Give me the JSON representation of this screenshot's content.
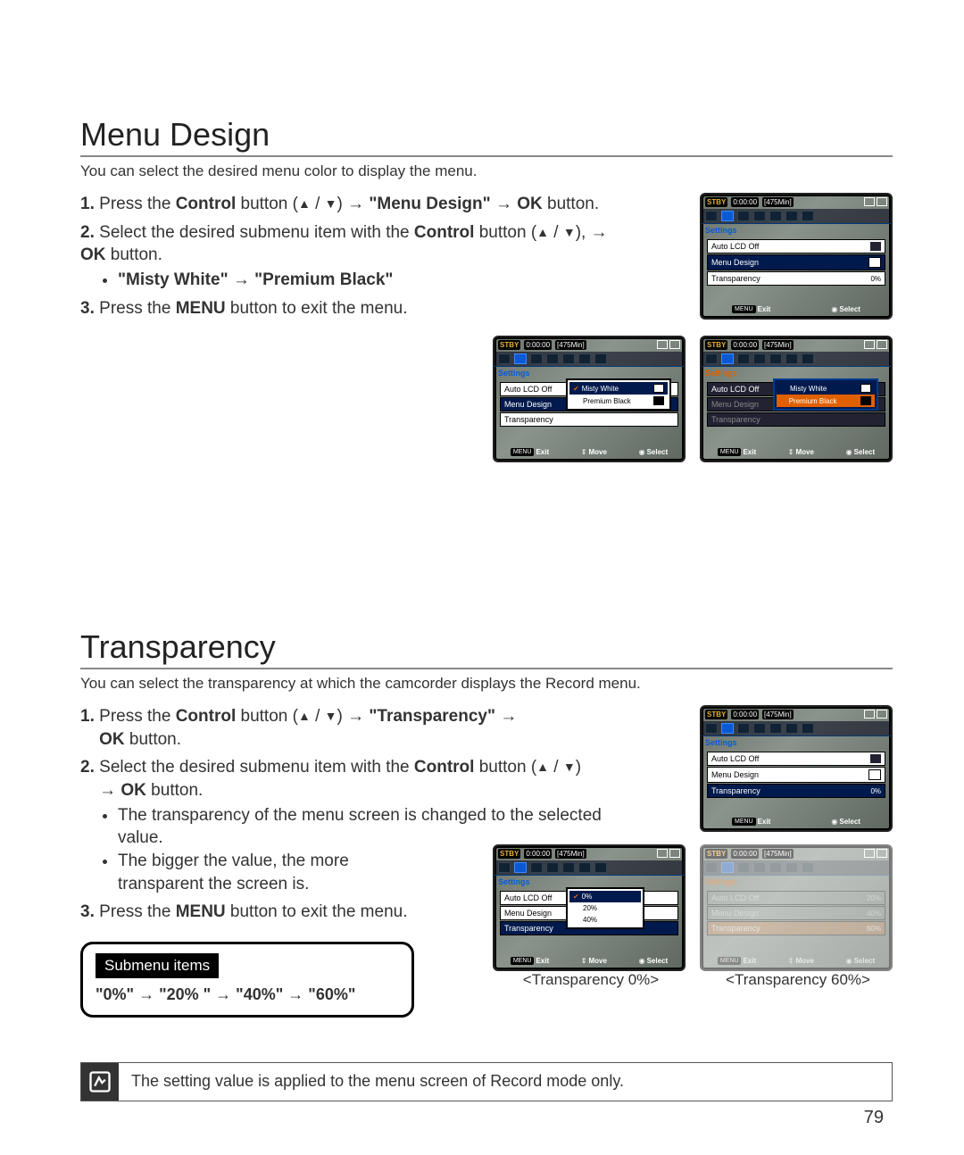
{
  "page_number": "79",
  "section1": {
    "title": "Menu Design",
    "lead": "You can select the desired menu color to display the menu.",
    "step1_a": "Press the ",
    "step1_b": "Control",
    "step1_c": " button (",
    "step1_d": ") ",
    "step1_e": "\"Menu Design\"",
    "step1_f": "OK",
    "step1_g": " button.",
    "step2_a": "Select the desired submenu item with the ",
    "step2_b": "Control",
    "step2_c": " button (",
    "step2_d": "), ",
    "step2_e": "OK",
    "step2_f": " button.",
    "bullet1": "\"Misty White\" → \"Premium Black\"",
    "step3_a": "Press the ",
    "step3_b": "MENU",
    "step3_c": " button to exit the menu."
  },
  "section2": {
    "title": "Transparency",
    "lead": "You can select the transparency at which the camcorder displays the Record menu.",
    "step1_a": "Press the ",
    "step1_b": "Control",
    "step1_c": " button (",
    "step1_d": ") ",
    "step1_e": "\"Transparency\"",
    "step1_f": "OK",
    "step1_g": " button.",
    "step2_a": "Select the desired submenu item with the ",
    "step2_b": "Control",
    "step2_c": " button (",
    "step2_d": ") ",
    "step2_e": "OK",
    "step2_f": " button.",
    "sub_b1": "The transparency of the menu screen is changed to the selected value.",
    "sub_b2": "The bigger the value, the more transparent the screen is.",
    "step3_a": "Press the ",
    "step3_b": "MENU",
    "step3_c": " button to exit the menu."
  },
  "submenu": {
    "title": "Submenu items",
    "text": "\"0%\" → \"20% \" → \"40%\" → \"60%\""
  },
  "note": "The setting value is applied to the menu screen of Record mode only.",
  "captions": {
    "c1": "<Transparency 0%>",
    "c2": "<Transparency 60%>"
  },
  "lcd": {
    "stby": "STBY",
    "time": "0:00:00",
    "remain": "[475Min]",
    "settings": "Settings",
    "auto_lcd": "Auto LCD Off",
    "menu_design": "Menu Design",
    "transparency": "Transparency",
    "val_0": "0%",
    "exit": "Exit",
    "move": "Move",
    "select": "Select",
    "menu_chip": "MENU",
    "misty": "Misty White",
    "premium": "Premium Black",
    "p0": "0%",
    "p20": "20%",
    "p40": "40%",
    "p60": "60%"
  }
}
